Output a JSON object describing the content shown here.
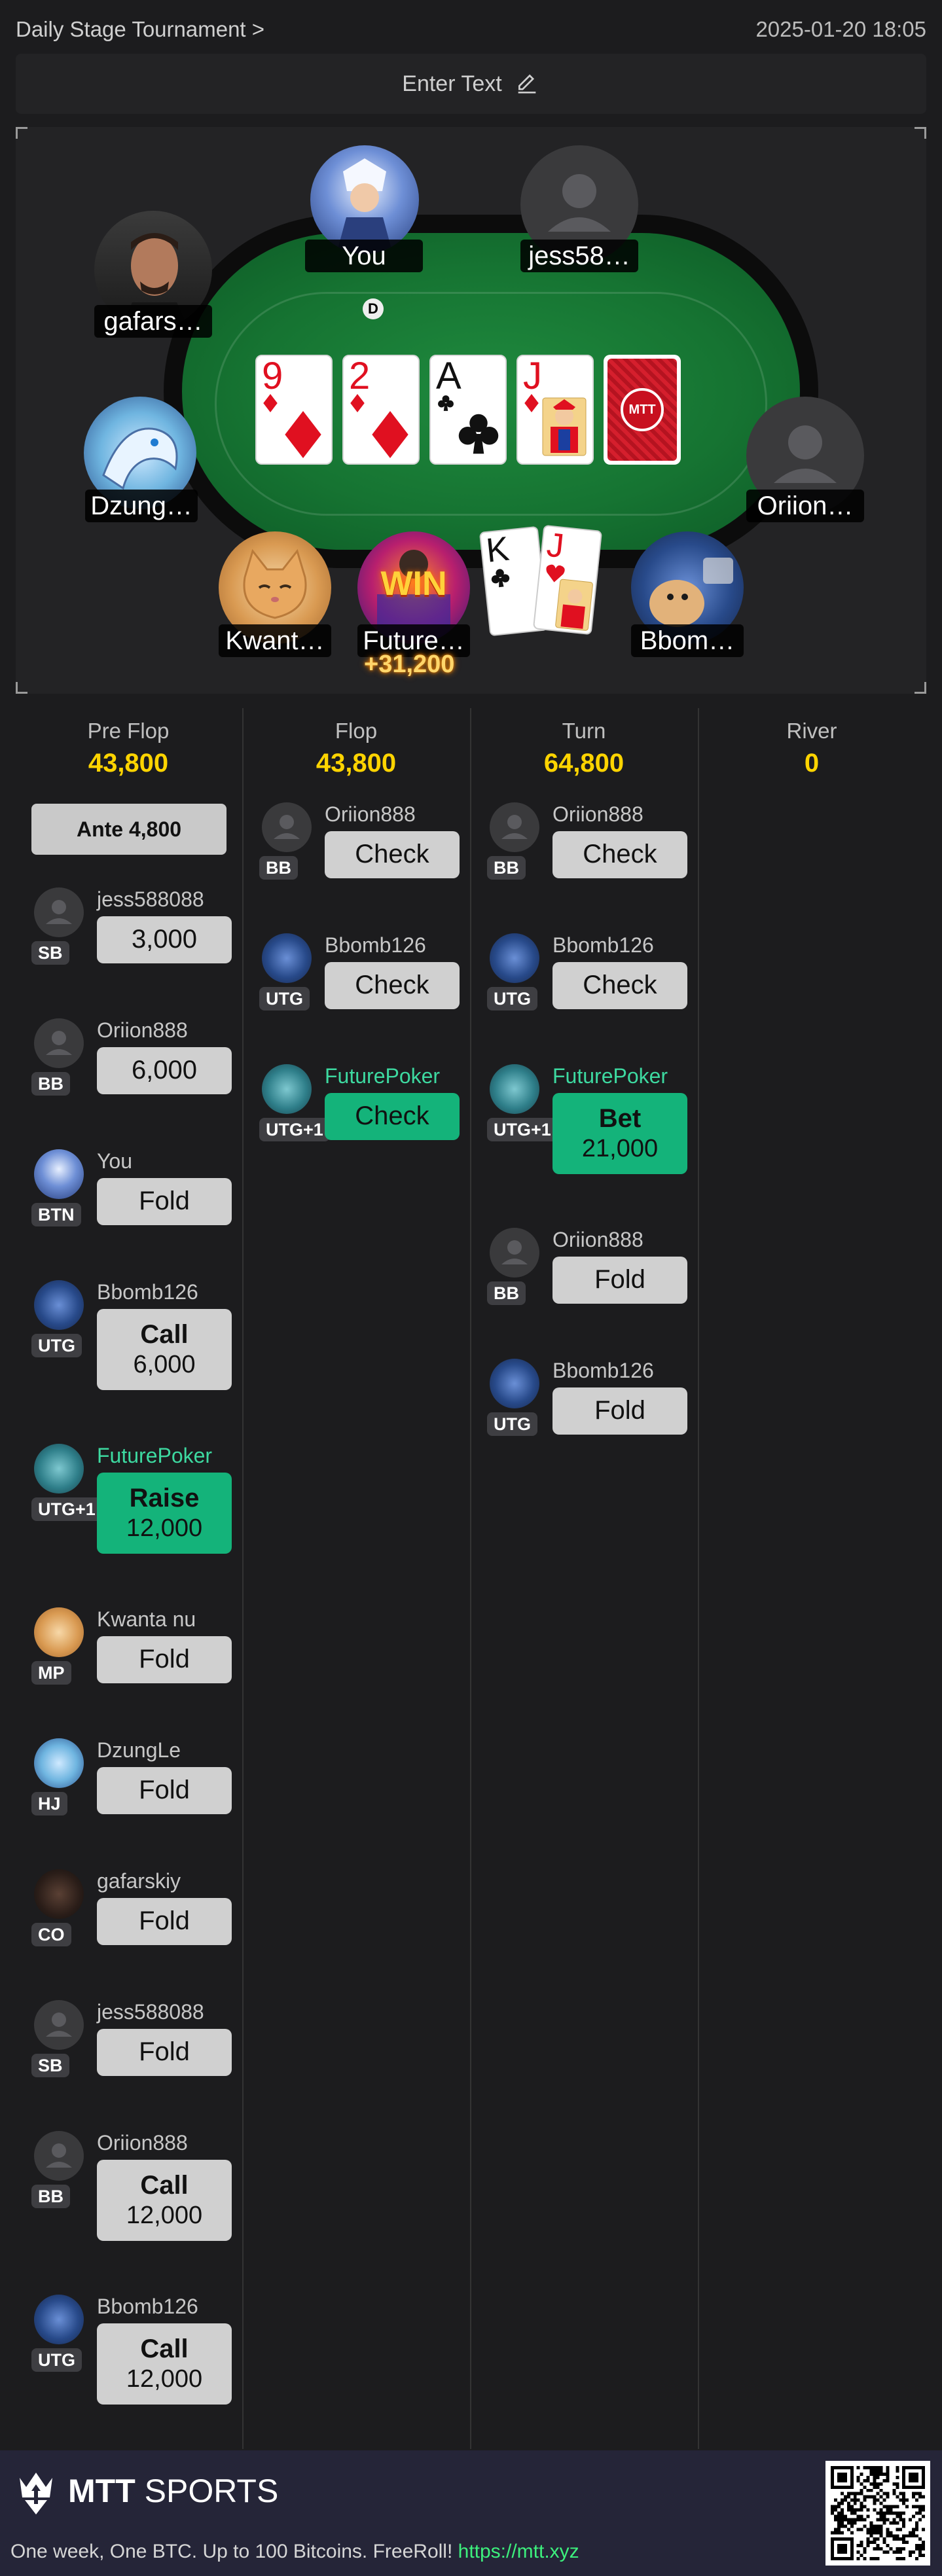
{
  "header": {
    "title": "Daily Stage Tournament >",
    "timestamp": "2025-01-20 18:05",
    "enter_text_label": "Enter Text"
  },
  "table": {
    "community_cards": [
      {
        "rank": "9",
        "suit": "diamond",
        "color": "#e01020"
      },
      {
        "rank": "2",
        "suit": "diamond",
        "color": "#e01020"
      },
      {
        "rank": "A",
        "suit": "club",
        "color": "#111111"
      },
      {
        "rank": "J",
        "suit": "diamond",
        "color": "#e01020"
      }
    ],
    "card_back_logo": "MTT",
    "dealer_button": "D",
    "seats": [
      {
        "name": "You",
        "avatar_icon": "anime-warrior-avatar"
      },
      {
        "name": "jess58…",
        "avatar_icon": "person-placeholder-icon"
      },
      {
        "name": "gafars…",
        "avatar_icon": "man-portrait-avatar"
      },
      {
        "name": "Dzung…",
        "avatar_icon": "dragon-avatar"
      },
      {
        "name": "Oriion…",
        "avatar_icon": "person-placeholder-icon"
      },
      {
        "name": "Kwant…",
        "avatar_icon": "cat-avatar"
      },
      {
        "name": "Future…",
        "avatar_icon": "win-avatar",
        "win_badge": "WIN",
        "win_amount": "+31,200"
      },
      {
        "name": "Bbom…",
        "avatar_icon": "hamster-avatar"
      }
    ],
    "hole_cards": [
      {
        "rank": "K",
        "suit": "club",
        "color": "#111111"
      },
      {
        "rank": "J",
        "suit": "heart",
        "color": "#e01020"
      }
    ]
  },
  "streets": [
    {
      "name": "Pre Flop",
      "pot": "43,800"
    },
    {
      "name": "Flop",
      "pot": "43,800"
    },
    {
      "name": "Turn",
      "pot": "64,800"
    },
    {
      "name": "River",
      "pot": "0"
    }
  ],
  "ante_label": "Ante 4,800",
  "actions": {
    "preflop": [
      {
        "player": "jess588088",
        "pos": "SB",
        "action": "3,000",
        "amount": ""
      },
      {
        "player": "Oriion888",
        "pos": "BB",
        "action": "6,000",
        "amount": ""
      },
      {
        "player": "You",
        "pos": "BTN",
        "action": "Fold",
        "amount": ""
      },
      {
        "player": "Bbomb126",
        "pos": "UTG",
        "action": "Call",
        "amount": "6,000"
      },
      {
        "player": "FuturePoker",
        "pos": "UTG+1",
        "action": "Raise",
        "amount": "12,000"
      },
      {
        "player": "Kwanta nu",
        "pos": "MP",
        "action": "Fold",
        "amount": ""
      },
      {
        "player": "DzungLe",
        "pos": "HJ",
        "action": "Fold",
        "amount": ""
      },
      {
        "player": "gafarskiy",
        "pos": "CO",
        "action": "Fold",
        "amount": ""
      },
      {
        "player": "jess588088",
        "pos": "SB",
        "action": "Fold",
        "amount": ""
      },
      {
        "player": "Oriion888",
        "pos": "BB",
        "action": "Call",
        "amount": "12,000"
      },
      {
        "player": "Bbomb126",
        "pos": "UTG",
        "action": "Call",
        "amount": "12,000"
      }
    ],
    "flop": [
      {
        "player": "Oriion888",
        "pos": "BB",
        "action": "Check",
        "amount": ""
      },
      {
        "player": "Bbomb126",
        "pos": "UTG",
        "action": "Check",
        "amount": ""
      },
      {
        "player": "FuturePoker",
        "pos": "UTG+1",
        "action": "Check",
        "amount": ""
      }
    ],
    "turn": [
      {
        "player": "Oriion888",
        "pos": "BB",
        "action": "Check",
        "amount": ""
      },
      {
        "player": "Bbomb126",
        "pos": "UTG",
        "action": "Check",
        "amount": ""
      },
      {
        "player": "FuturePoker",
        "pos": "UTG+1",
        "action": "Bet",
        "amount": "21,000"
      },
      {
        "player": "Oriion888",
        "pos": "BB",
        "action": "Fold",
        "amount": ""
      },
      {
        "player": "Bbomb126",
        "pos": "UTG",
        "action": "Fold",
        "amount": ""
      }
    ]
  },
  "footer": {
    "brand_strong": "MTT",
    "brand_rest": "SPORTS",
    "tagline": "One week, One BTC. Up to 100 Bitcoins. FreeRoll! ",
    "link": "https://mtt.xyz"
  },
  "colors": {
    "background": "#1c1c1e",
    "pot_yellow": "#ffd400",
    "hero_green": "#14b37a",
    "footer_bg": "#252538"
  }
}
